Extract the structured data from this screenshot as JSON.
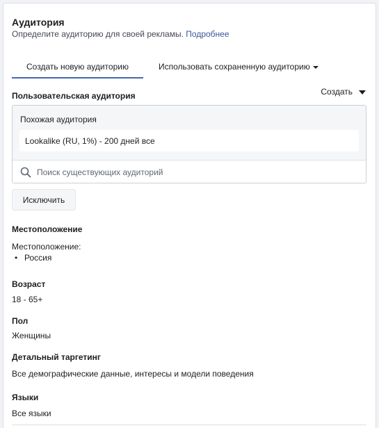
{
  "header": {
    "title": "Аудитория",
    "subtitle": "Определите аудиторию для своей рекламы.",
    "more_link": "Подробнее"
  },
  "tabs": [
    {
      "label": "Создать новую аудиторию",
      "active": true
    },
    {
      "label": "Использовать сохраненную аудиторию",
      "active": false
    }
  ],
  "custom_audience": {
    "label": "Пользовательская аудитория",
    "create_label": "Создать",
    "lookalike_heading": "Похожая аудитория",
    "selected_item": "Lookalike (RU, 1%) - 200 дней все",
    "search_placeholder": "Поиск существующих аудиторий",
    "exclude_label": "Исключить"
  },
  "location": {
    "label": "Местоположение",
    "sub_label": "Местоположение:",
    "items": [
      "Россия"
    ]
  },
  "age": {
    "label": "Возраст",
    "value": "18 - 65+"
  },
  "gender": {
    "label": "Пол",
    "value": "Женщины"
  },
  "detailed_targeting": {
    "label": "Детальный таргетинг",
    "value": "Все демографические данные, интересы и модели поведения"
  },
  "languages": {
    "label": "Языки",
    "value": "Все языки"
  },
  "colors": {
    "accent": "#4267b2",
    "link": "#385898"
  }
}
